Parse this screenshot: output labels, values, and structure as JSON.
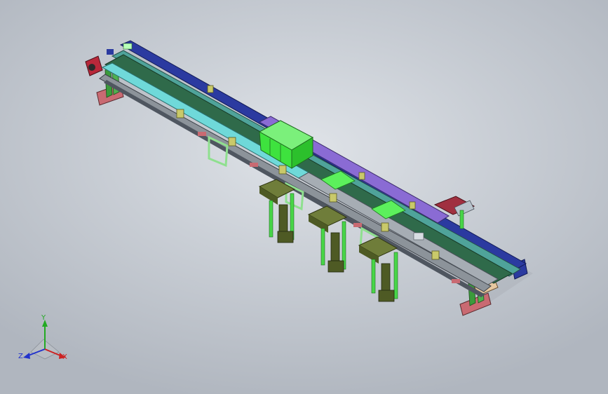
{
  "viewport": {
    "background_center": "#dfe3e8",
    "background_edge": "#b0b6bf"
  },
  "model": {
    "colors": {
      "belt": "#2f6a4a",
      "rail_cyan": "#6fd9d9",
      "rail_blue": "#2b3aa0",
      "rail_purple": "#8a6bd4",
      "frame_gray": "#8c939a",
      "frame_dark": "#4f5660",
      "frame_teal": "#4fa39a",
      "leg_pink": "#c96a72",
      "leg_green": "#3b9b3b",
      "cylinder_green": "#48d648",
      "plate_olive": "#6f7d3a",
      "bracket_green": "#8fe08f",
      "tray_green": "#3ee23e",
      "plate_lime": "#5cf05c",
      "tag_khaki": "#c9c96a",
      "accent_red": "#b8283a"
    }
  },
  "triad": {
    "y_label": "Y",
    "z_label": "Z",
    "x_label": "X",
    "y_color": "#22aa22",
    "z_color": "#2233cc",
    "x_color": "#cc2222"
  }
}
